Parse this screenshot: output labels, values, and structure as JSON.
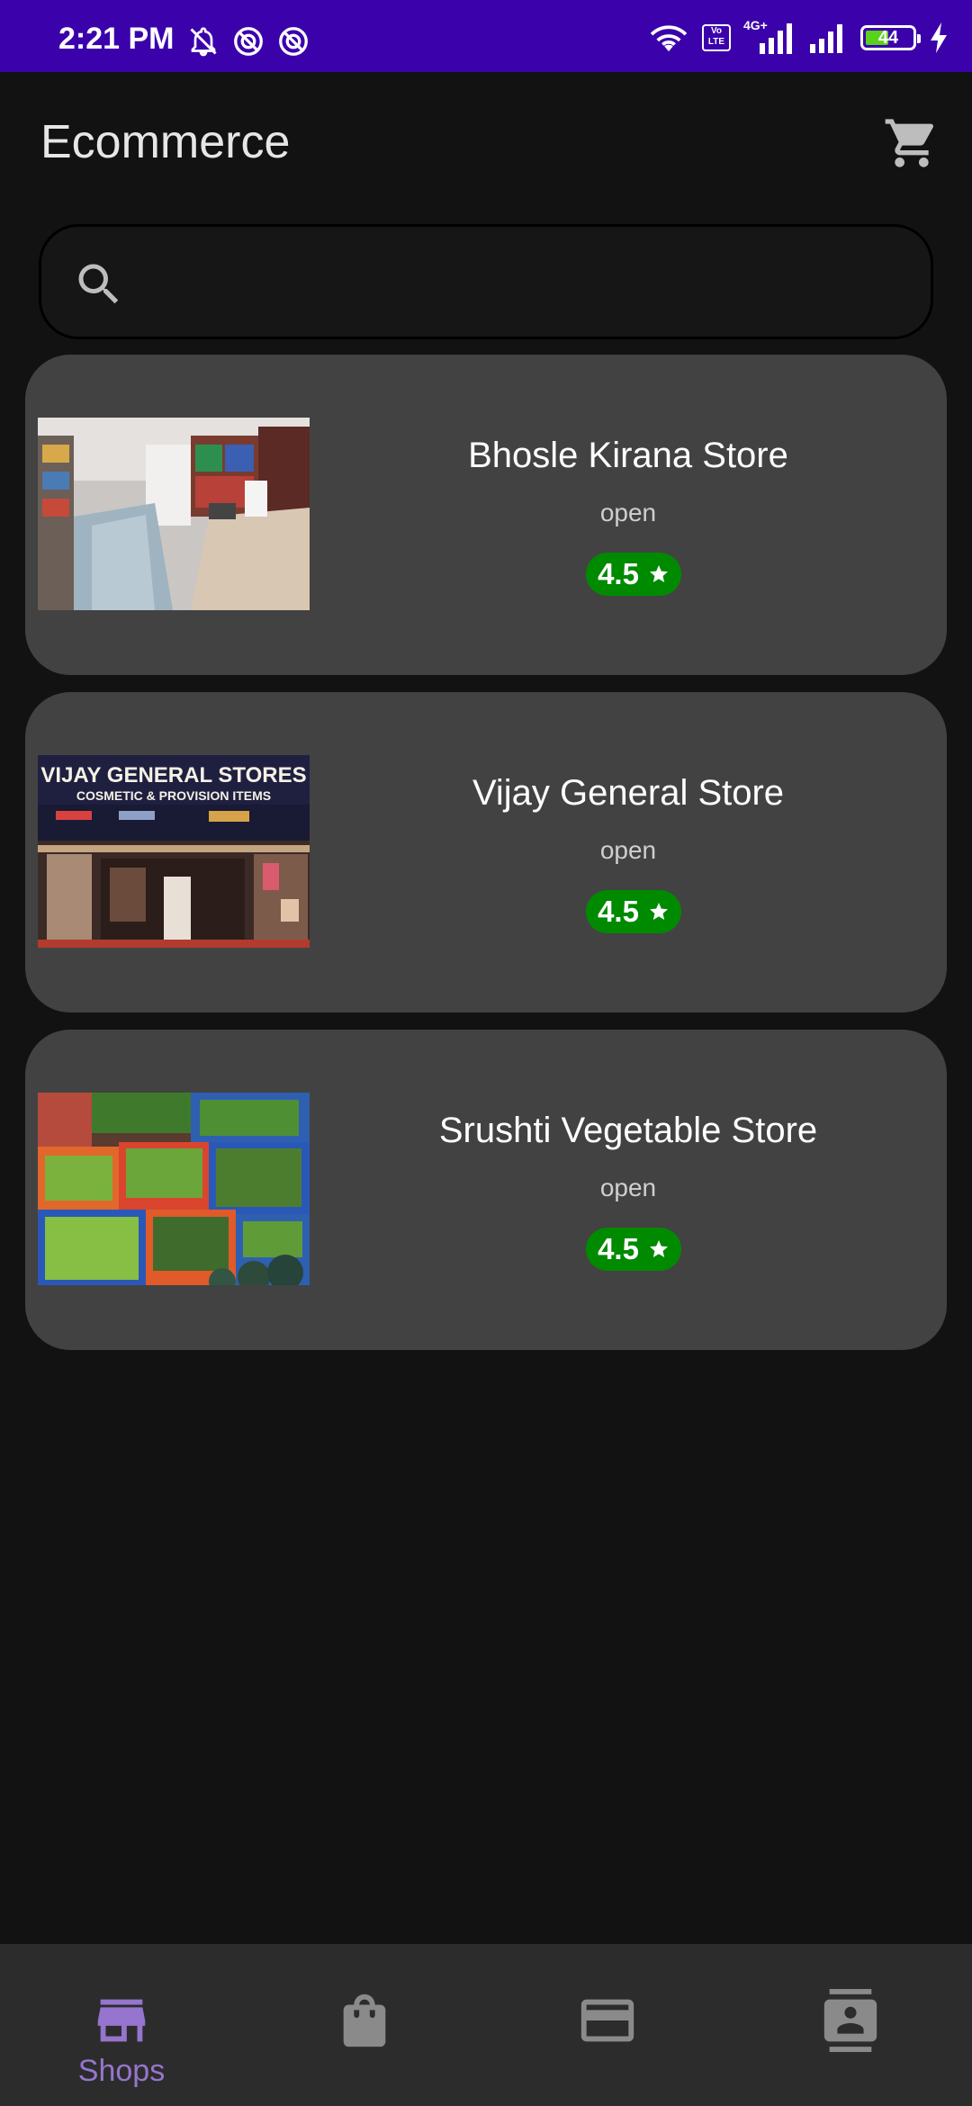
{
  "status_bar": {
    "time": "2:21 PM",
    "network_label": "4G+",
    "volte_label": "Vo LTE",
    "battery_level": "44",
    "icons": [
      "mute-icon",
      "do-not-disturb-icon",
      "do-not-disturb-icon",
      "wifi-icon",
      "volte-icon",
      "signal-icon",
      "signal-icon",
      "battery-icon",
      "charging-icon"
    ]
  },
  "app_bar": {
    "title": "Ecommerce",
    "cart_icon": "cart-icon"
  },
  "search": {
    "placeholder": "",
    "value": "",
    "icon": "search-icon"
  },
  "stores": [
    {
      "name": "Bhosle Kirana Store",
      "status": "open",
      "rating": "4.5",
      "image": "grocery-interior-photo"
    },
    {
      "name": "Vijay General Store",
      "status": "open",
      "rating": "4.5",
      "image": "general-store-front-photo",
      "sign_line1": "VIJAY GENERAL STORES",
      "sign_line2": "COSMETIC & PROVISION ITEMS"
    },
    {
      "name": "Srushti Vegetable Store",
      "status": "open",
      "rating": "4.5",
      "image": "vegetable-crates-photo"
    }
  ],
  "bottom_nav": {
    "items": [
      {
        "label": "Shops",
        "icon": "store-icon",
        "active": true
      },
      {
        "label": "",
        "icon": "shopping-bag-icon",
        "active": false
      },
      {
        "label": "",
        "icon": "credit-card-icon",
        "active": false
      },
      {
        "label": "",
        "icon": "contact-icon",
        "active": false
      }
    ]
  },
  "colors": {
    "status_bar": "#3b02ac",
    "background": "#121212",
    "card": "#424242",
    "rating_badge": "#008a00",
    "nav_active": "#9575cd",
    "nav_inactive": "#8a8a8a"
  }
}
